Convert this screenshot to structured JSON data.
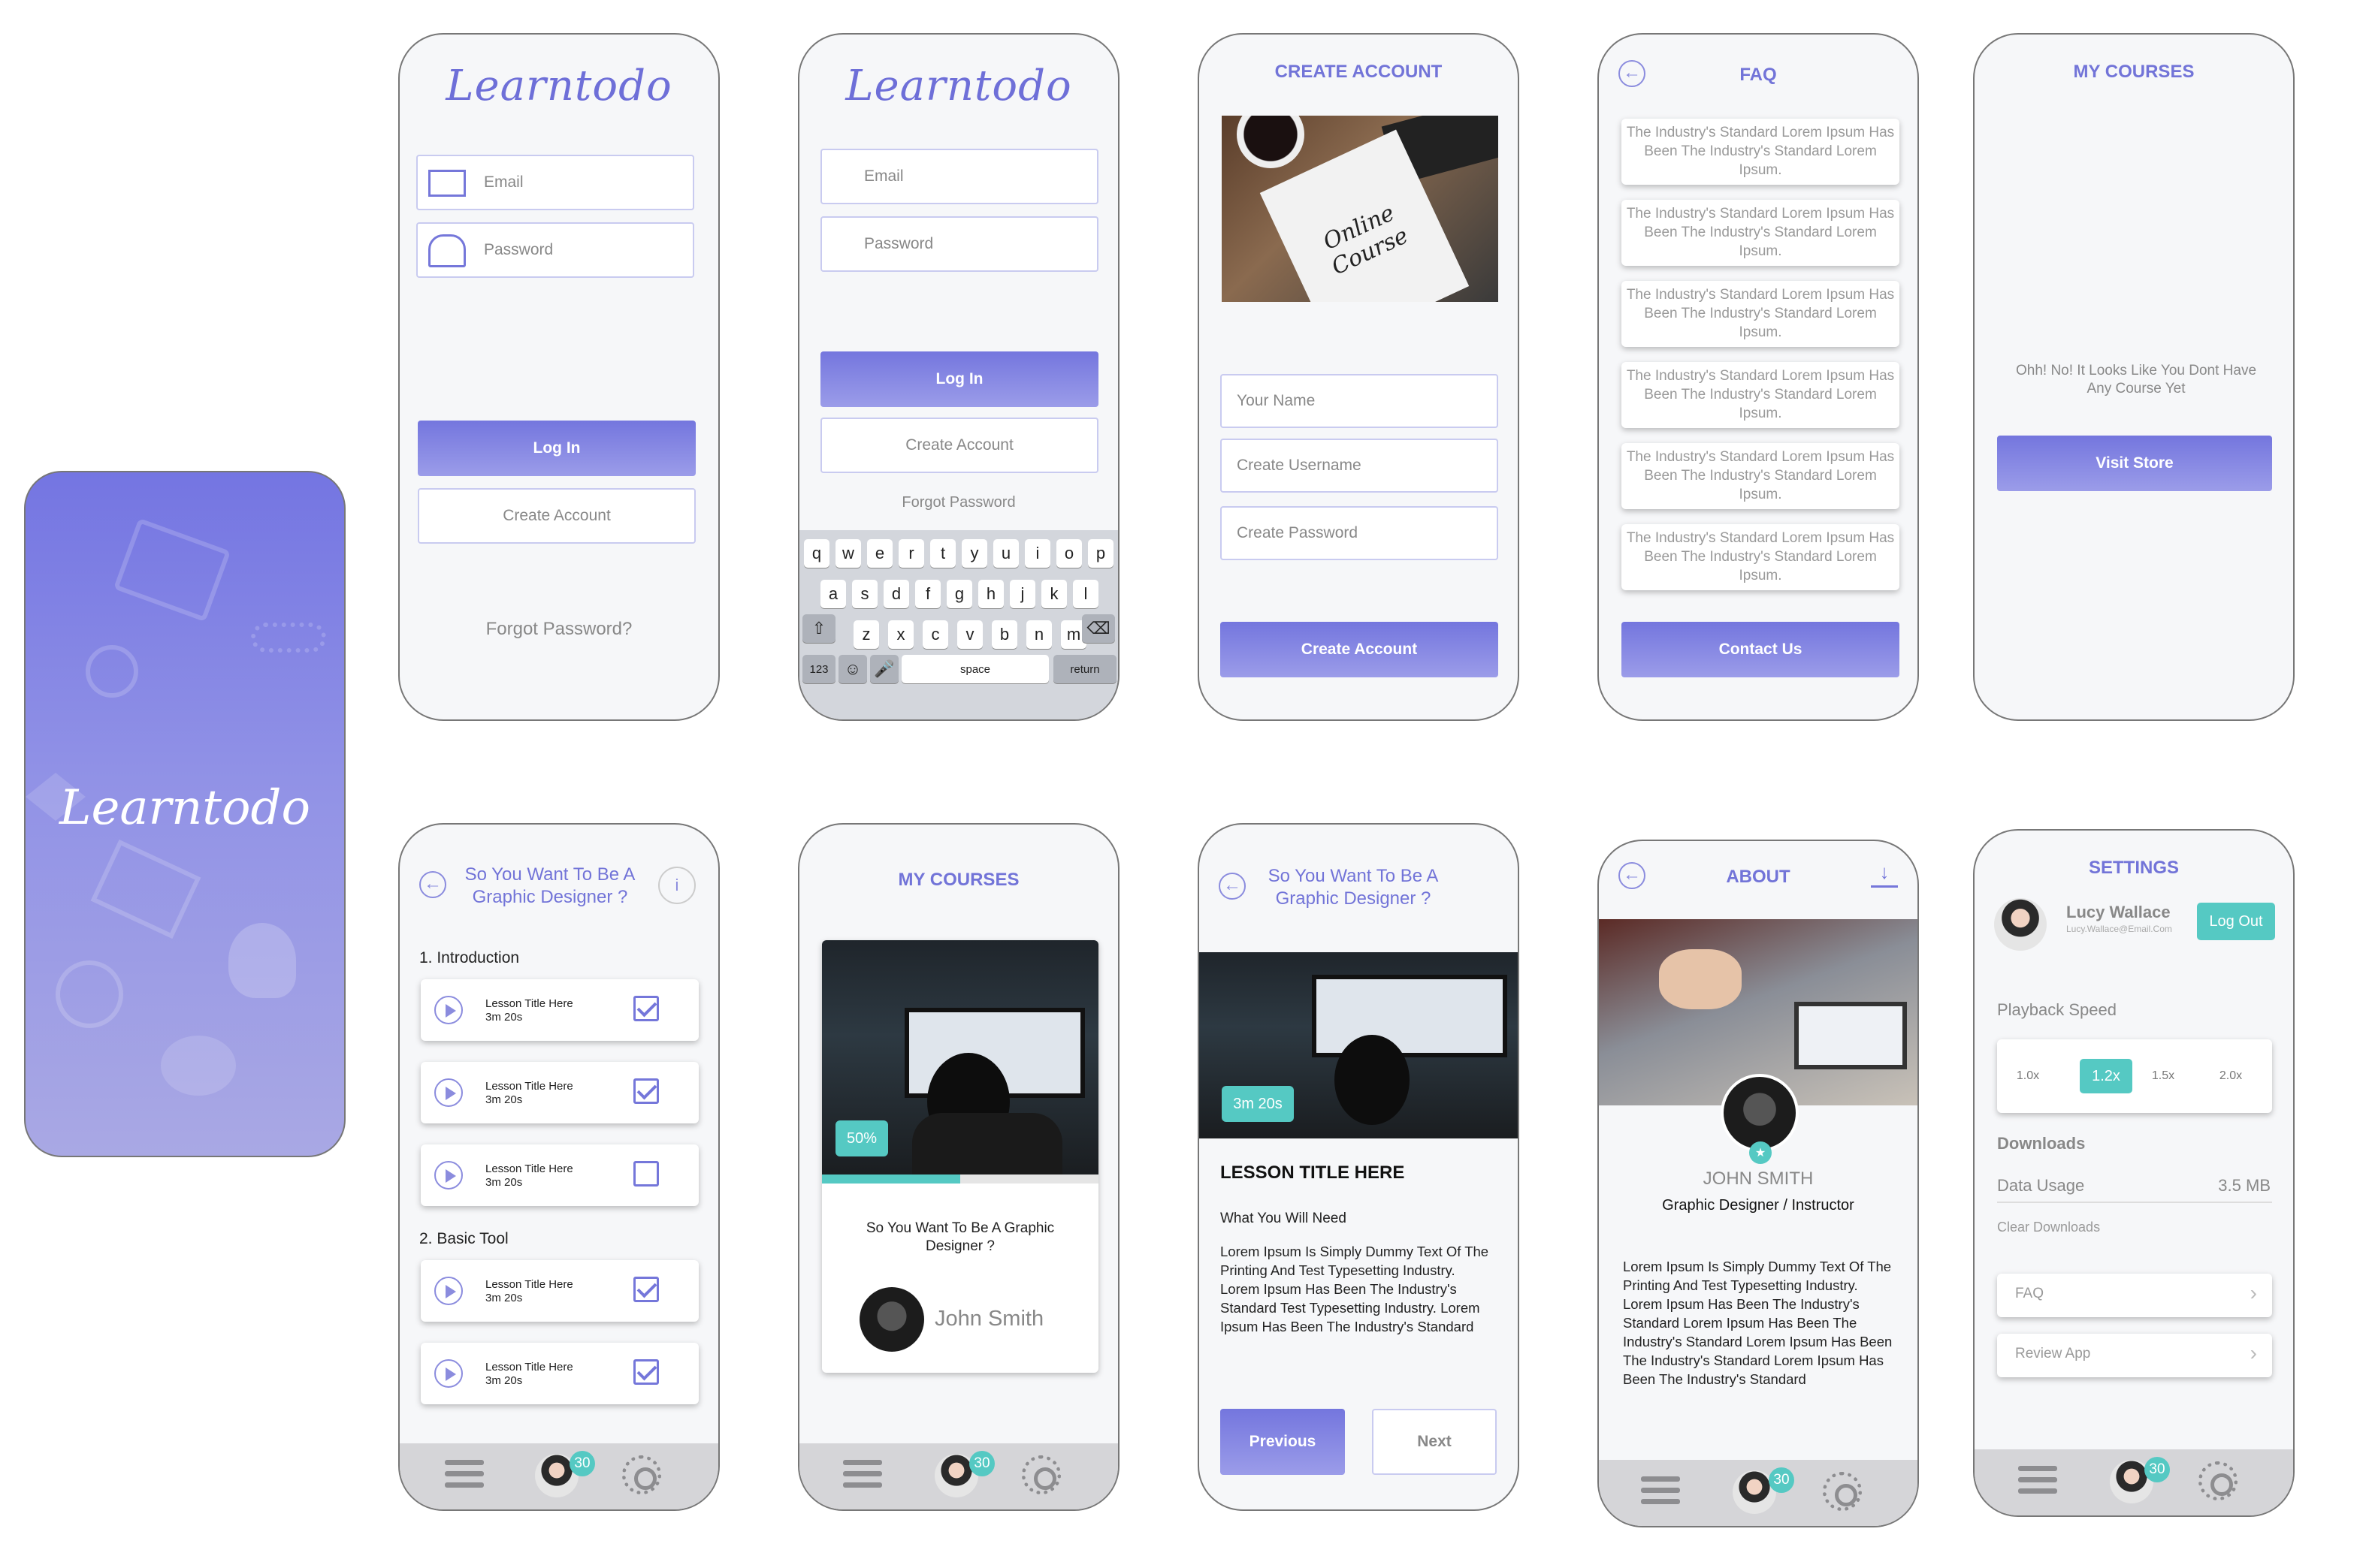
{
  "app_name": "Learntodo",
  "colors": {
    "accent": "#7476de",
    "teal": "#55c9c3",
    "bg": "#f6f7f9"
  },
  "splash": {
    "logo": "Learntodo"
  },
  "login1": {
    "logo": "Learntodo",
    "email_placeholder": "Email",
    "password_placeholder": "Password",
    "login": "Log In",
    "create": "Create Account",
    "forgot": "Forgot Password?"
  },
  "login2": {
    "logo": "Learntodo",
    "email_placeholder": "Email",
    "password_placeholder": "Password",
    "login": "Log In",
    "create": "Create Account",
    "forgot": "Forgot Password",
    "keyboard": {
      "row1": [
        "q",
        "w",
        "e",
        "r",
        "t",
        "y",
        "u",
        "i",
        "o",
        "p"
      ],
      "row2": [
        "a",
        "s",
        "d",
        "f",
        "g",
        "h",
        "j",
        "k",
        "l"
      ],
      "row3": [
        "z",
        "x",
        "c",
        "v",
        "b",
        "n",
        "m"
      ],
      "num": "123",
      "space": "space",
      "ret": "return"
    }
  },
  "create": {
    "title": "CREATE ACCOUNT",
    "photo_text": "Online Course",
    "name": "Your Name",
    "username": "Create Username",
    "password": "Create Password",
    "button": "Create Account"
  },
  "faq": {
    "title": "FAQ",
    "items": [
      "The Industry's Standard Lorem Ipsum Has Been The Industry's Standard Lorem Ipsum.",
      "The Industry's Standard Lorem Ipsum Has Been The Industry's Standard Lorem Ipsum.",
      "The Industry's Standard Lorem Ipsum Has Been The Industry's Standard Lorem Ipsum.",
      "The Industry's Standard Lorem Ipsum Has Been The Industry's Standard Lorem Ipsum.",
      "The Industry's Standard Lorem Ipsum Has Been The Industry's Standard Lorem Ipsum.",
      "The Industry's Standard Lorem Ipsum Has Been The Industry's Standard Lorem Ipsum."
    ],
    "contact": "Contact Us"
  },
  "mycourses_empty": {
    "title": "MY COURSES",
    "message": "Ohh! No! It Looks Like You Dont Have Any Course Yet",
    "button": "Visit Store"
  },
  "course_detail": {
    "title": "So You Want To Be A Graphic Designer ?",
    "info": "i",
    "section1": "1. Introduction",
    "section2": "2. Basic Tool",
    "lessons": [
      {
        "title": "Lesson Title Here",
        "duration": "3m 20s",
        "done": true
      },
      {
        "title": "Lesson Title Here",
        "duration": "3m 20s",
        "done": true
      },
      {
        "title": "Lesson Title Here",
        "duration": "3m 20s",
        "done": false
      },
      {
        "title": "Lesson Title Here",
        "duration": "3m 20s",
        "done": true
      },
      {
        "title": "Lesson Title Here",
        "duration": "3m 20s",
        "done": true
      }
    ]
  },
  "tabbar": {
    "badge": "30"
  },
  "mycourses": {
    "title": "MY COURSES",
    "progress_label": "50%",
    "progress": 0.5,
    "course": "So You Want To Be A Graphic Designer ?",
    "author": "John Smith"
  },
  "lesson": {
    "title": "So You Want To Be A Graphic Designer ?",
    "duration": "3m 20s",
    "heading": "LESSON TITLE HERE",
    "sub": "What You Will Need",
    "body": "Lorem Ipsum Is Simply Dummy Text Of The Printing And  Test Typesetting Industry. Lorem Ipsum Has Been The Industry's Standard Test Typesetting Industry.  Lorem Ipsum Has Been The Industry's Standard",
    "prev": "Previous",
    "next": "Next"
  },
  "about": {
    "title": "ABOUT",
    "name": "JOHN SMITH",
    "role": "Graphic Designer / Instructor",
    "body": "Lorem Ipsum Is Simply Dummy Text Of The Printing And  Test Typesetting Industry. Lorem Ipsum Has Been The Industry's Standard Lorem Ipsum Has Been The Industry's Standard Lorem Ipsum Has Been The Industry's Standard Lorem Ipsum Has Been The Industry's Standard"
  },
  "settings": {
    "title": "SETTINGS",
    "name": "Lucy Wallace",
    "email": "Lucy.Wallace@Email.Com",
    "logout": "Log Out",
    "playback": "Playback Speed",
    "speeds": [
      "1.0x",
      "1.2x",
      "1.5x",
      "2.0x"
    ],
    "selected_speed": "1.2x",
    "downloads": "Downloads",
    "data_usage": "Data Usage",
    "data_value": "3.5 MB",
    "clear": "Clear Downloads",
    "faq": "FAQ",
    "review": "Review App"
  }
}
